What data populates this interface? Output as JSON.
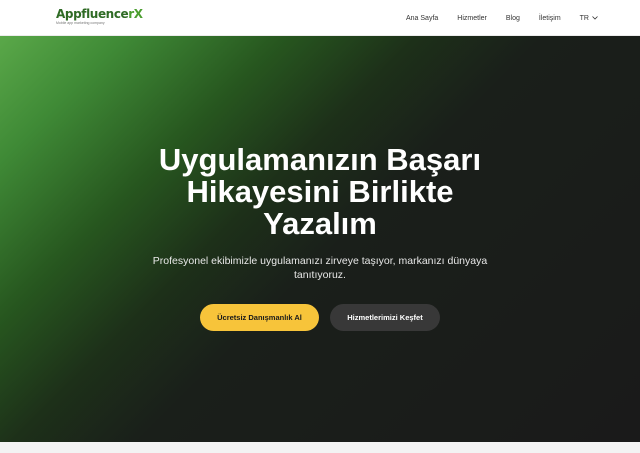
{
  "header": {
    "logo": {
      "name_part1": "Appfluence",
      "name_part2": "rX",
      "tagline": "Mobile app marketing company"
    },
    "nav": [
      {
        "label": "Ana Sayfa"
      },
      {
        "label": "Hizmetler"
      },
      {
        "label": "Blog"
      },
      {
        "label": "İletişim"
      }
    ],
    "language": {
      "label": "TR",
      "icon": "chevron-down-icon"
    }
  },
  "hero": {
    "title_lines": [
      "Uygulamanızın Başarı",
      "Hikayesini Birlikte",
      "Yazalım"
    ],
    "subtitle": "Profesyonel ekibimizle uygulamanızı zirveye taşıyor, markanızı dünyaya tanıtıyoruz.",
    "primary_button": "Ücretsiz Danışmanlık Al",
    "secondary_button": "Hizmetlerimizi Keşfet"
  },
  "colors": {
    "brand_green": "#4b9e2f",
    "accent_yellow": "#f7c43a",
    "hero_dark": "#1a1a1a"
  }
}
